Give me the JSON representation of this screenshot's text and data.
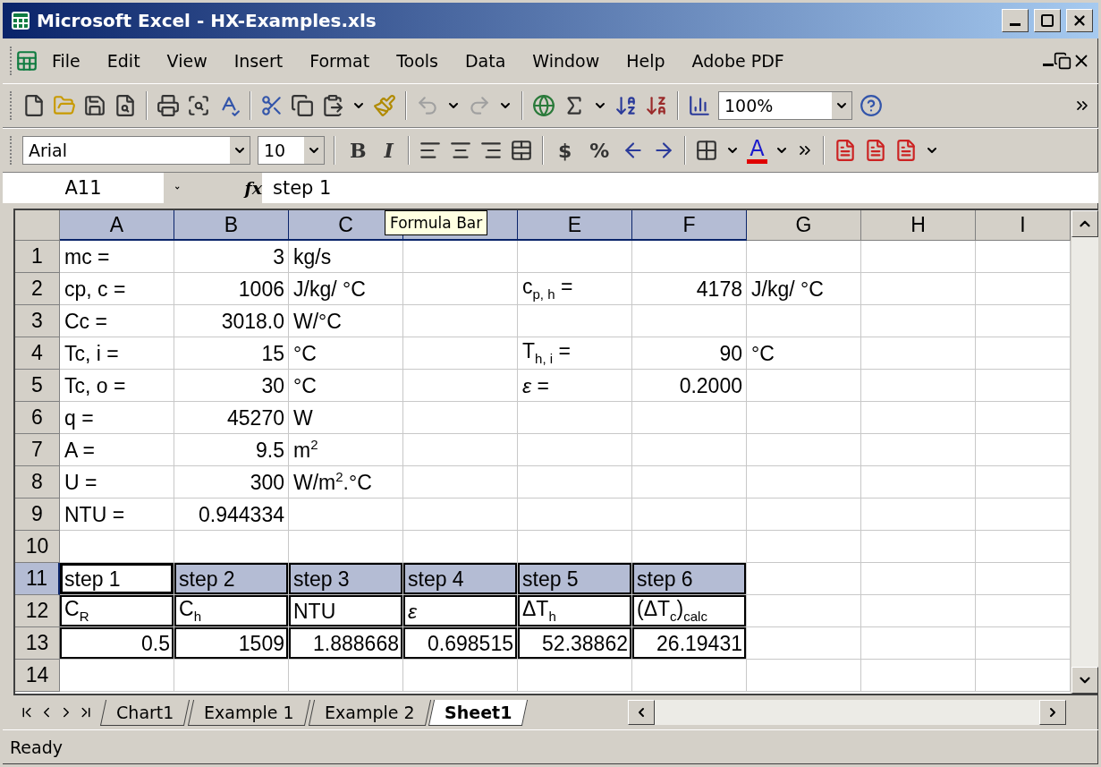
{
  "window": {
    "title": "Microsoft Excel - HX-Examples.xls"
  },
  "menu": [
    "File",
    "Edit",
    "View",
    "Insert",
    "Format",
    "Tools",
    "Data",
    "Window",
    "Help",
    "Adobe PDF"
  ],
  "standard_toolbar": {
    "zoom": "100%"
  },
  "formatting_toolbar": {
    "font": "Arial",
    "size": "10",
    "bold": "B",
    "italic": "I",
    "currency": "$",
    "percent": "%",
    "font_color": "A"
  },
  "formula_bar": {
    "name_box": "A11",
    "function_label": "fx",
    "formula": "step 1"
  },
  "tooltip": "Formula Bar",
  "columns": [
    {
      "label": "A",
      "selected": true
    },
    {
      "label": "B",
      "selected": true
    },
    {
      "label": "C",
      "selected": true
    },
    {
      "selected": true
    },
    {
      "label": "E",
      "selected": true
    },
    {
      "label": "F",
      "selected": true
    },
    {
      "label": "G",
      "selected": false
    },
    {
      "label": "H",
      "selected": false
    },
    {
      "label": "I",
      "selected": false
    }
  ],
  "rows": [
    {
      "label": "1",
      "selected": false,
      "boxed": false,
      "cells": [
        {
          "text": "mc ="
        },
        {
          "text": "3",
          "kind": "number"
        },
        {
          "text": "kg/s"
        }
      ]
    },
    {
      "label": "2",
      "selected": false,
      "boxed": false,
      "cells": [
        {
          "text": "cp, c ="
        },
        {
          "text": "1006",
          "kind": "number"
        },
        {
          "text": "J/kg/ °C"
        },
        null,
        {
          "text": "c$_{p, h}$ ="
        },
        {
          "text": "4178",
          "kind": "number"
        },
        {
          "text": "J/kg/ °C"
        }
      ]
    },
    {
      "label": "3",
      "selected": false,
      "boxed": false,
      "cells": [
        {
          "text": "Cc ="
        },
        {
          "text": "3018.0",
          "kind": "number"
        },
        {
          "text": "W/°C"
        }
      ]
    },
    {
      "label": "4",
      "selected": false,
      "boxed": false,
      "cells": [
        {
          "text": "Tc, i ="
        },
        {
          "text": "15",
          "kind": "number"
        },
        {
          "text": "°C"
        },
        null,
        {
          "text": "T$_{h, i}$ ="
        },
        {
          "text": "90",
          "kind": "number"
        },
        {
          "text": "°C"
        }
      ]
    },
    {
      "label": "5",
      "selected": false,
      "boxed": false,
      "cells": [
        {
          "text": "Tc, o ="
        },
        {
          "text": "30",
          "kind": "number"
        },
        {
          "text": "°C"
        },
        null,
        {
          "text": "*ε* ="
        },
        {
          "text": "0.2000",
          "kind": "number"
        }
      ]
    },
    {
      "label": "6",
      "selected": false,
      "boxed": false,
      "cells": [
        {
          "text": "q ="
        },
        {
          "text": "45270",
          "kind": "number"
        },
        {
          "text": "W"
        }
      ]
    },
    {
      "label": "7",
      "selected": false,
      "boxed": false,
      "cells": [
        {
          "text": "A ="
        },
        {
          "text": "9.5",
          "kind": "number"
        },
        {
          "text": "m$^{2}$"
        }
      ]
    },
    {
      "label": "8",
      "selected": false,
      "boxed": false,
      "cells": [
        {
          "text": "U ="
        },
        {
          "text": "300",
          "kind": "number"
        },
        {
          "text": "W/m$^{2}$.°C"
        }
      ]
    },
    {
      "label": "9",
      "selected": false,
      "boxed": false,
      "cells": [
        {
          "text": "NTU ="
        },
        {
          "text": "0.944334",
          "kind": "number"
        }
      ]
    },
    {
      "label": "10",
      "selected": false,
      "boxed": false
    },
    {
      "label": "11",
      "selected": true,
      "boxed": true,
      "cells": [
        {
          "text": "step 1",
          "active": true
        },
        {
          "text": "step 2",
          "active": false
        },
        {
          "text": "step 3",
          "active": false
        },
        {
          "text": "step 4",
          "active": false
        },
        {
          "text": "step 5",
          "active": false
        },
        {
          "text": "step 6",
          "active": false
        }
      ]
    },
    {
      "label": "12",
      "selected": false,
      "boxed": true,
      "cells": [
        {
          "text": "C$_{R}$"
        },
        {
          "text": "C$_{h}$"
        },
        {
          "text": "NTU"
        },
        {
          "text": "*ε*"
        },
        {
          "text": "ΔT$_{h}$"
        },
        {
          "text": "(ΔT$_{c}$)$_{calc}$"
        }
      ]
    },
    {
      "label": "13",
      "selected": false,
      "boxed": true,
      "cells": [
        {
          "text": "0.5",
          "kind": "number"
        },
        {
          "text": "1509",
          "kind": "number"
        },
        {
          "text": "1.888668",
          "kind": "number"
        },
        {
          "text": "0.698515",
          "kind": "number"
        },
        {
          "text": "52.38862",
          "kind": "number"
        },
        {
          "text": "26.19431",
          "kind": "number"
        }
      ]
    },
    {
      "label": "14",
      "selected": false,
      "boxed": false
    }
  ],
  "sheet_tabs": [
    {
      "label": "Chart1",
      "selected": false
    },
    {
      "label": "Example 1",
      "selected": false
    },
    {
      "label": "Example 2",
      "selected": false
    },
    {
      "label": "Sheet1",
      "selected": true
    }
  ],
  "status_bar": {
    "text": "Ready"
  }
}
